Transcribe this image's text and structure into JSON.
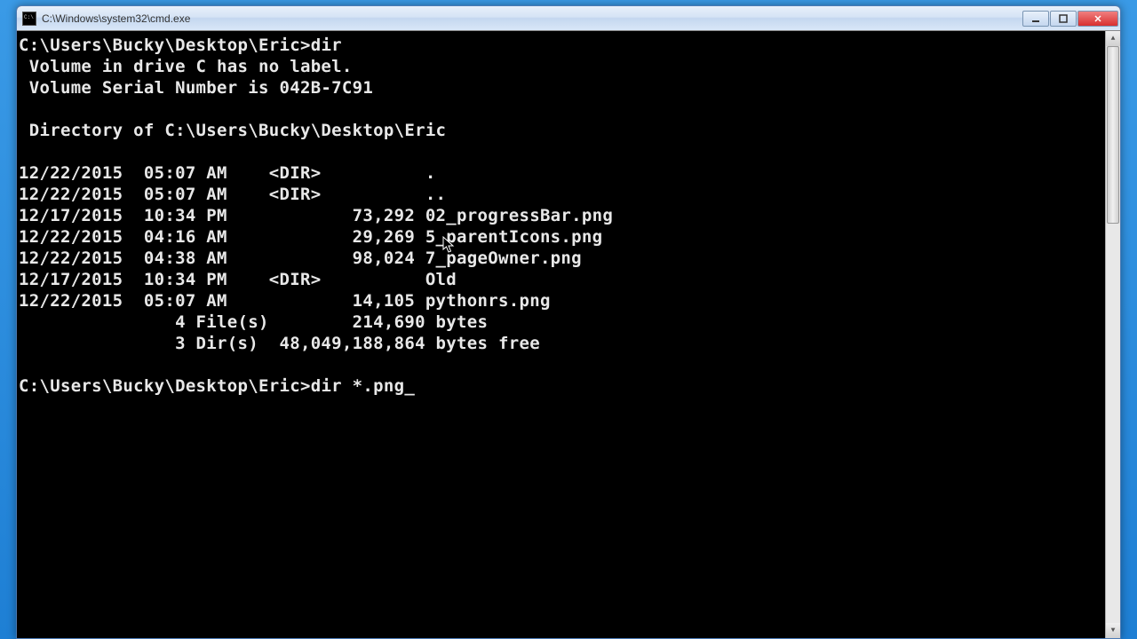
{
  "window": {
    "title": "C:\\Windows\\system32\\cmd.exe"
  },
  "terminal": {
    "prompt1": "C:\\Users\\Bucky\\Desktop\\Eric>",
    "command1": "dir",
    "volume_line": " Volume in drive C has no label.",
    "serial_line": " Volume Serial Number is 042B-7C91",
    "dir_of_line": " Directory of C:\\Users\\Bucky\\Desktop\\Eric",
    "entries": [
      "12/22/2015  05:07 AM    <DIR>          .",
      "12/22/2015  05:07 AM    <DIR>          ..",
      "12/17/2015  10:34 PM            73,292 02_progressBar.png",
      "12/22/2015  04:16 AM            29,269 5_parentIcons.png",
      "12/22/2015  04:38 AM            98,024 7_pageOwner.png",
      "12/17/2015  10:34 PM    <DIR>          Old",
      "12/22/2015  05:07 AM            14,105 pythonrs.png"
    ],
    "summary_files": "               4 File(s)        214,690 bytes",
    "summary_dirs": "               3 Dir(s)  48,049,188,864 bytes free",
    "prompt2": "C:\\Users\\Bucky\\Desktop\\Eric>",
    "command2": "dir *.png"
  }
}
